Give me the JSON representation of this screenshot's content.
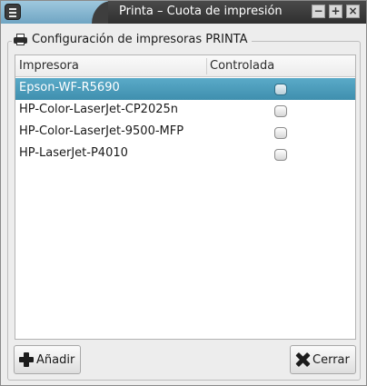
{
  "window": {
    "title": "Printa – Cuota de impresión",
    "controls": {
      "minimize": "−",
      "maximize": "+",
      "close": "×"
    }
  },
  "group": {
    "label": "Configuración de impresoras PRINTA",
    "icon": "printer-icon"
  },
  "table": {
    "columns": [
      "Impresora",
      "Controlada"
    ],
    "rows": [
      {
        "name": "Epson-WF-R5690",
        "controlled": false,
        "selected": true
      },
      {
        "name": "HP-Color-LaserJet-CP2025n",
        "controlled": false,
        "selected": false
      },
      {
        "name": "HP-Color-LaserJet-9500-MFP",
        "controlled": false,
        "selected": false
      },
      {
        "name": "HP-LaserJet-P4010",
        "controlled": false,
        "selected": false
      }
    ]
  },
  "buttons": {
    "add": {
      "label": "Añadir",
      "icon": "plus-icon"
    },
    "close": {
      "label": "Cerrar",
      "icon": "x-icon"
    }
  },
  "colors": {
    "selection": "#4a9dbd",
    "titlebar_dark": "#3a3a3a",
    "titlebar_accent": "#7fb3cf"
  }
}
